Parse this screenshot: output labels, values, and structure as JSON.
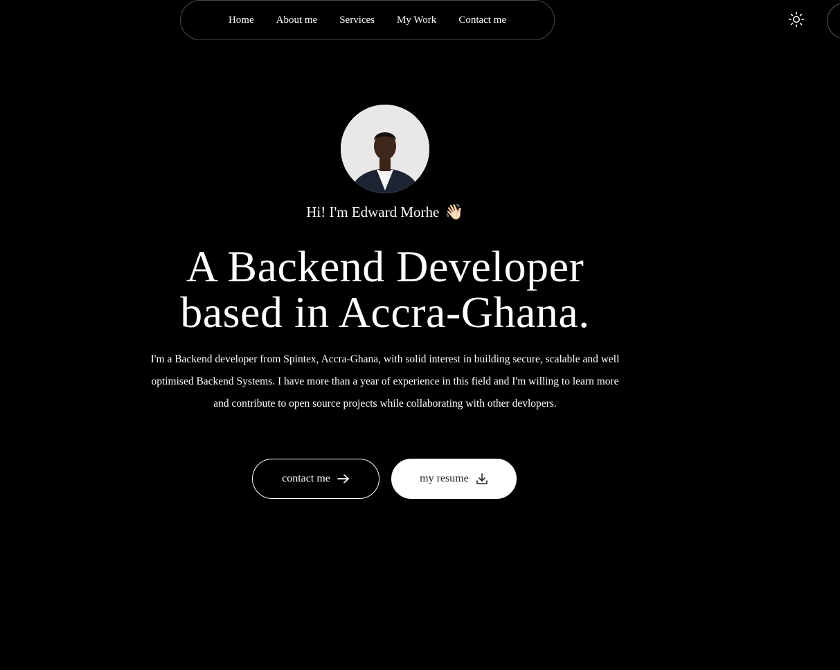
{
  "nav": {
    "items": [
      {
        "label": "Home"
      },
      {
        "label": "About me"
      },
      {
        "label": "Services"
      },
      {
        "label": "My Work"
      },
      {
        "label": "Contact me"
      }
    ],
    "theme_icon": "sun-icon"
  },
  "hero": {
    "greeting": "Hi! I'm Edward Morhe",
    "greeting_emoji": "👋🏻",
    "headline_line1": "A Backend Developer",
    "headline_line2": "based in Accra-Ghana.",
    "bio": "I'm a Backend developer from Spintex, Accra-Ghana, with solid interest in building secure, scalable and well optimised Backend Systems. I have more than a year of experience in this field and I'm willing to learn more and contribute to open source projects while collaborating with other devlopers.",
    "contact_label": "contact me",
    "contact_icon": "arrow-right-icon",
    "resume_label": "my resume",
    "resume_icon": "download-icon"
  },
  "colors": {
    "background": "#000000",
    "text": "#ffffff",
    "border": "#4a4a4a"
  }
}
